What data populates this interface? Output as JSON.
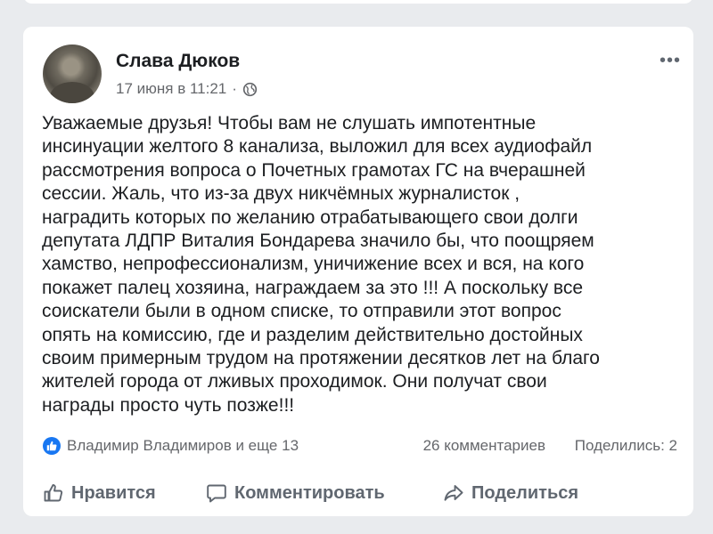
{
  "post": {
    "author": "Слава Дюков",
    "timestamp": "17 июня в 11:21",
    "separator": "·",
    "privacy_icon": "globe-icon",
    "more_label": "•••",
    "text": "Уважаемые друзья! Чтобы вам не слушать импотентные\nинсинуации желтого 8 канализа, выложил для всех аудиофайл\nрассмотрения вопроса о Почетных грамотах ГС на вчерашней\nсессии. Жаль, что из-за двух никчёмных журналисток ,\nнаградить которых по желанию отрабатывающего свои долги\nдепутата ЛДПР Виталия Бондарева значило бы, что поощряем\nхамство, непрофессионализм, уничижение всех и вся, на кого\nпокажет палец хозяина, награждаем за это !!! А поскольку все\nсоискатели были в одном списке, то отправили этот вопрос\nопять на комиссию, где и разделим действительно достойных\nсвоим примерным трудом на протяжении десятков лет на благо\nжителей города от лживых проходимок. Они получат свои\nнаграды просто чуть позже!!!"
  },
  "stats": {
    "reaction_icon": "like-icon",
    "reactors": "Владимир Владимиров и еще 13",
    "comments": "26 комментариев",
    "shares": "Поделились: 2"
  },
  "actions": {
    "like": "Нравится",
    "comment": "Комментировать",
    "share": "Поделиться"
  },
  "colors": {
    "accent": "#1877f2",
    "secondary_text": "#65676b",
    "background": "#e9ebee"
  }
}
